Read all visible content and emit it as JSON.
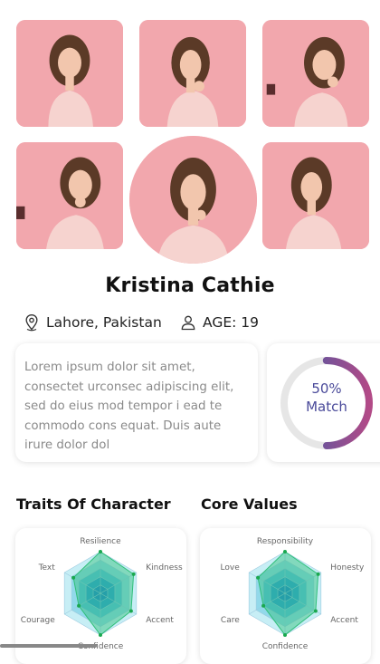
{
  "profile": {
    "name": "Kristina Cathie",
    "location": "Lahore, Pakistan",
    "age": "AGE: 19"
  },
  "bio": "Lorem ipsum dolor sit amet, consectet urconsec adipiscing elit, sed do eius mod tempor i ead te commodo cons equat. Duis aute irure dolor dol",
  "match": {
    "percent": "50%",
    "label": "Match",
    "value": 0.5
  },
  "traits": {
    "title": "Traits Of Character",
    "labels": [
      "Resilience",
      "Kindness",
      "Accent",
      "Confidence",
      "Courage",
      "Text"
    ]
  },
  "core_values": {
    "title": "Core Values",
    "labels": [
      "Responsibility",
      "Honesty",
      "Accent",
      "Confidence",
      "Care",
      "Love"
    ]
  },
  "colors": {
    "photo_bg": "#f2a7ad",
    "match_gradient_start": "#3d5aa8",
    "match_gradient_end": "#b24a87",
    "radar_fill": "#2fbf7a"
  },
  "icons": {
    "location": "location-pin-icon",
    "person": "person-icon"
  }
}
